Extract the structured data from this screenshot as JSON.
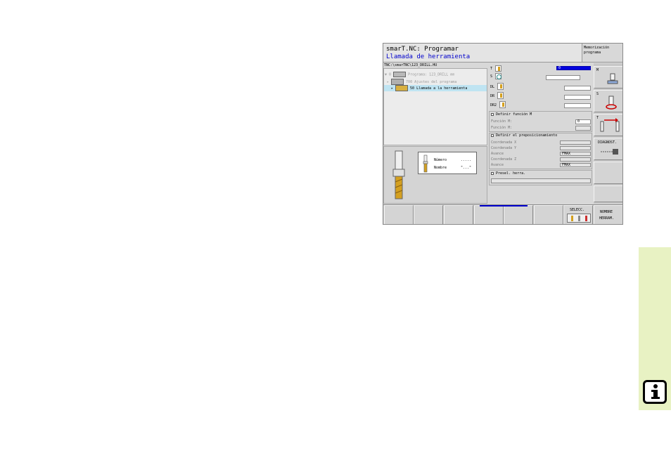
{
  "header": {
    "title_line1": "smarT.NC: Programar",
    "title_line2": "Llamada de herramienta",
    "mode_label": "Memorización programa"
  },
  "path": "TNC:\\smarTNC\\123_DRILL.HU",
  "tree": {
    "items": [
      {
        "num": "0",
        "label": "Programa: 123_DRILL mm"
      },
      {
        "num": "",
        "label": "700 Ajustes del programa"
      },
      {
        "num": "",
        "label": "50 Llamada a la herramienta"
      }
    ]
  },
  "help": {
    "number_label": "Número",
    "number_value": ".....",
    "name_label": "Nombre",
    "name_value": "\"...\""
  },
  "form": {
    "t_label": "T",
    "t_value": "0",
    "s_label": "S",
    "s_value": "",
    "dl_label": "DL",
    "dl_value": "",
    "dr_label": "DR",
    "dr_value": "",
    "dr2_label": "DR2",
    "dr2_value": "",
    "m_section": "Definir función M",
    "m1_label": "Función M:",
    "m1_value": "0",
    "m2_label": "Función M:",
    "m2_value": "",
    "pos_section": "Definir el preposicionamiento",
    "x_label": "Coordenada X",
    "y_label": "Coordenada Y",
    "feed1_label": "Avance",
    "feed1_value": "FMAX",
    "z_label": "Coordenada Z",
    "feed2_label": "Avance",
    "feed2_value": "FMAX",
    "presel_section": "Presel. herra."
  },
  "vertical_softkeys": {
    "m_label": "M",
    "s_label": "S",
    "t_label": "T",
    "diag_label": "DIAGNOST."
  },
  "softkeys": {
    "select_label": "SELECC.",
    "name_label_1": "NOMBRE",
    "name_label_2": "HERRAM."
  },
  "colors": {
    "title_blue": "#0000cc",
    "select_blue": "#0000dd",
    "info_green": "#e8f2c3",
    "tree_highlight": "#bfe4f2"
  }
}
